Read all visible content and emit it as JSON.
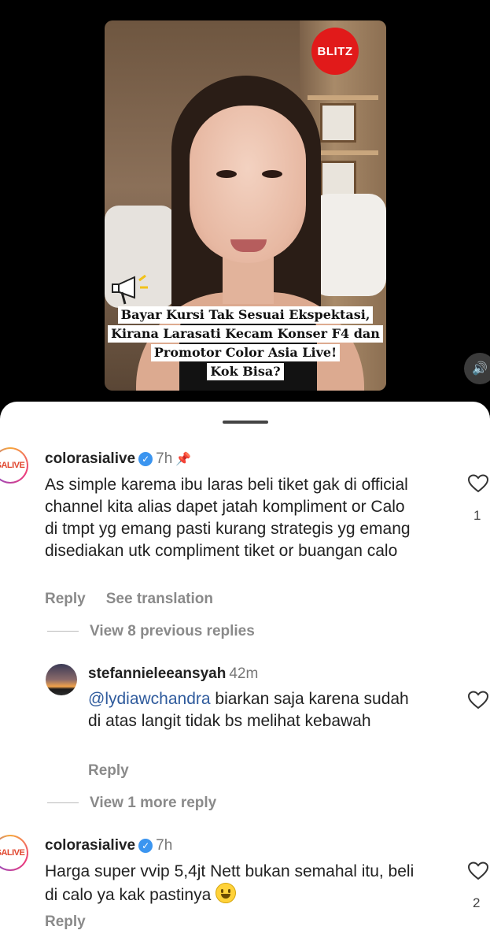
{
  "video": {
    "logo": "BLITZ",
    "headline_lines": [
      "Bayar Kursi Tak Sesuai Ekspektasi,",
      "Kirana Larasati Kecam Konser F4 dan",
      "Promotor Color Asia Live!",
      "Kok Bisa?"
    ],
    "volume_icon": "speaker-icon"
  },
  "comments": [
    {
      "avatar_text": "SALIVE",
      "username": "colorasialive",
      "verified": true,
      "time": "7h",
      "pinned": true,
      "text": "As simple karema ibu laras beli tiket gak di official channel kita alias dapet jatah kompliment or Calo di tmpt yg emang pasti kurang strategis yg emang disediakan utk compliment tiket or buangan calo",
      "likes": "1",
      "reply_label": "Reply",
      "translate_label": "See translation",
      "view_replies": "View 8 previous replies"
    },
    {
      "username": "stefannieleeansyah",
      "time": "42m",
      "mention": "@lydiawchandra",
      "text": " biarkan saja karena sudah di atas langit tidak bs melihat kebawah",
      "reply_label": "Reply",
      "view_replies": "View 1 more reply"
    },
    {
      "avatar_text": "SALIVE",
      "username": "colorasialive",
      "verified": true,
      "time": "7h",
      "text": "Harga super vvip 5,4jt Nett  bukan semahal itu, beli di calo ya kak pastinya ",
      "likes": "2",
      "reply_label": "Reply"
    }
  ]
}
